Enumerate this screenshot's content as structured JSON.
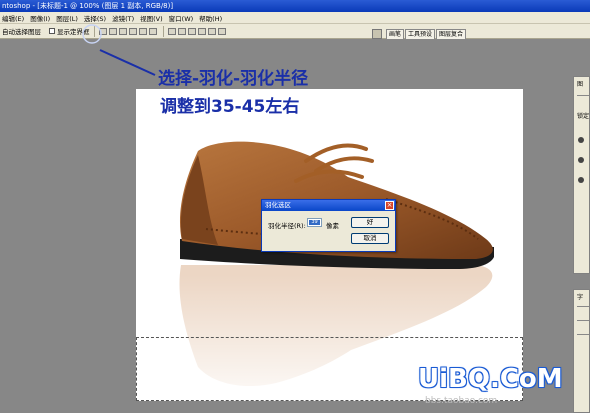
{
  "window": {
    "title": "ntoshop - [未标题-1 @ 100% (图层 1 副本, RGB/8)]"
  },
  "menu": {
    "items": [
      "编辑(E)",
      "图像(I)",
      "图层(L)",
      "选择(S)",
      "滤镜(T)",
      "视图(V)",
      "窗口(W)",
      "帮助(H)"
    ]
  },
  "options_bar": {
    "auto_select_label": "自动选择图层",
    "show_bounds_label": "显示定界框"
  },
  "palette_well": {
    "tabs": [
      "画笔",
      "工具预设",
      "图层复合"
    ]
  },
  "annotation": {
    "line1": "选择-羽化-羽化半径",
    "line2": "调整到35-45左右"
  },
  "feather_dialog": {
    "title": "羽化选区",
    "radius_label": "羽化半径(R):",
    "radius_value": "39",
    "unit": "像素",
    "ok_label": "好",
    "cancel_label": "取消"
  },
  "right_panels": {
    "top_tab": "图",
    "lock_label": "锁定",
    "bottom_tab": "字"
  },
  "watermark": {
    "brand": "UiBQ.CoM",
    "url": "bbs.taobao.com"
  },
  "colors": {
    "annotation_blue": "#1a2fa8",
    "titlebar_blue": "#0a3ab8",
    "shoe_brown": "#9c5a2a"
  }
}
